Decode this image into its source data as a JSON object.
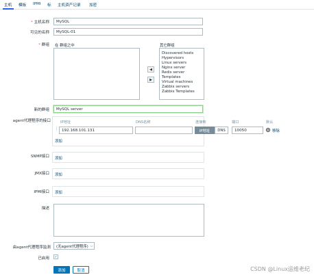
{
  "tabs": [
    {
      "label": "主机"
    },
    {
      "label": "模板"
    },
    {
      "label": "IPMI"
    },
    {
      "label": "标"
    },
    {
      "label": "主机资产记录"
    },
    {
      "label": "加密"
    }
  ],
  "host_name": {
    "label": "主机名称",
    "value": "MySQL"
  },
  "visible_name": {
    "label": "可见的名称",
    "value": "MySQL-01"
  },
  "groups": {
    "label": "群组",
    "in_groups_label": "在 群组之中",
    "other_groups_label": "其它群组",
    "other_groups": [
      "Discovered hosts",
      "Hypervisors",
      "Linux servers",
      "Nginx server",
      "Redis server",
      "Templates",
      "Virtual machines",
      "Zabbix servers",
      "Zabbix Templates"
    ],
    "add_arrow": "◀",
    "remove_arrow": "▶"
  },
  "new_group": {
    "label": "新的群组",
    "value": "MySQL server"
  },
  "agent_interfaces": {
    "label": "agent代理程序的接口",
    "col_ip": "IP地址",
    "col_dns": "DNS名称",
    "col_connect": "连接到",
    "col_port": "端口",
    "col_default": "默认",
    "ip_value": "192.168.101.131",
    "dns_value": "",
    "connect_ip": "IP地址",
    "connect_dns": "DNS",
    "port_value": "10050",
    "remove_label": "移除",
    "add_label": "添加"
  },
  "snmp": {
    "label": "SNMP接口",
    "add_label": "添加"
  },
  "jmx": {
    "label": "JMX接口",
    "add_label": "添加"
  },
  "ipmi": {
    "label": "IPMI接口",
    "add_label": "添加"
  },
  "description": {
    "label": "描述",
    "value": ""
  },
  "proxy": {
    "label": "由agent代理程序监测",
    "value": "(无agent代理程序)"
  },
  "enabled": {
    "label": "已启用",
    "checked": true
  },
  "buttons": {
    "add": "添加",
    "cancel": "取消"
  },
  "watermark": "CSDN @Linux运维老纪"
}
